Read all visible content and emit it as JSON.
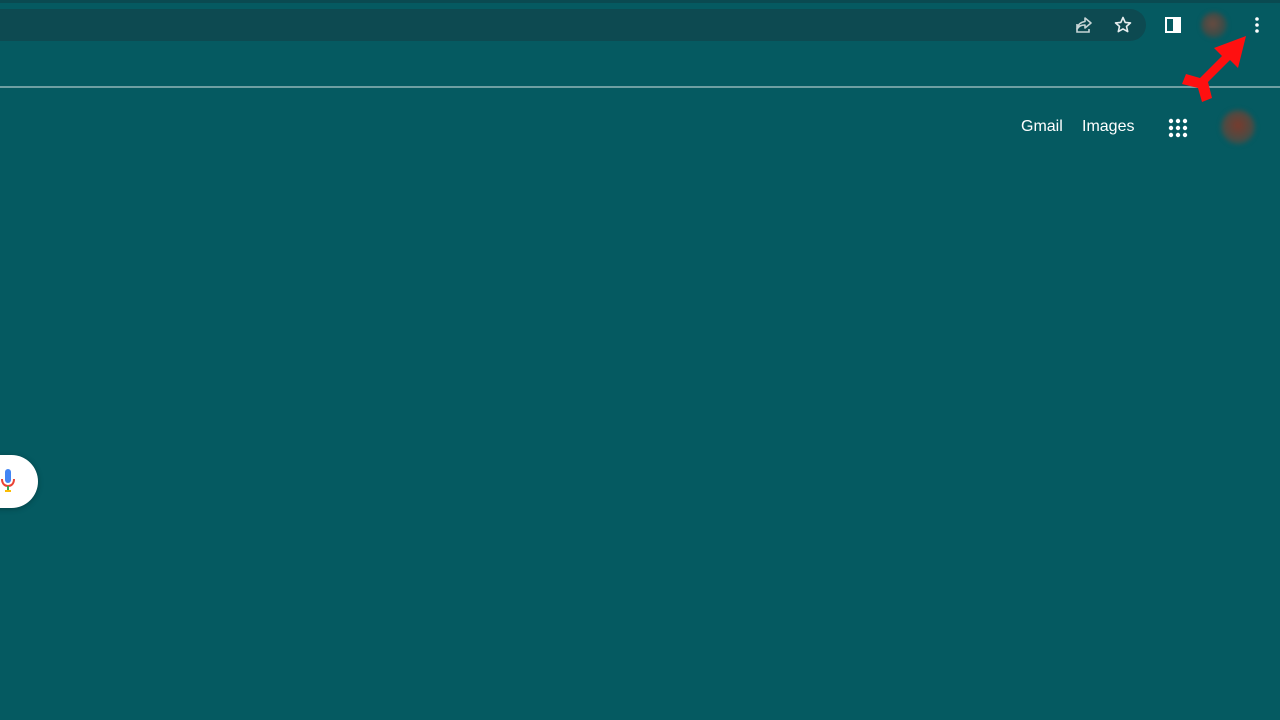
{
  "browser": {
    "toolbar": {
      "share_icon": "share-icon",
      "bookmark_icon": "star-icon",
      "side_panel_icon": "side-panel-icon",
      "profile_icon": "avatar",
      "menu_icon": "three-dot-menu-icon"
    }
  },
  "google_header": {
    "gmail": "Gmail",
    "images": "Images",
    "apps_icon": "apps-grid-icon",
    "account_icon": "account-avatar"
  },
  "search": {
    "voice_icon": "mic-icon"
  },
  "colors": {
    "page_background": "#055a61",
    "omnibox_background": "#0d4a51",
    "annotation_arrow": "#ff1010"
  }
}
